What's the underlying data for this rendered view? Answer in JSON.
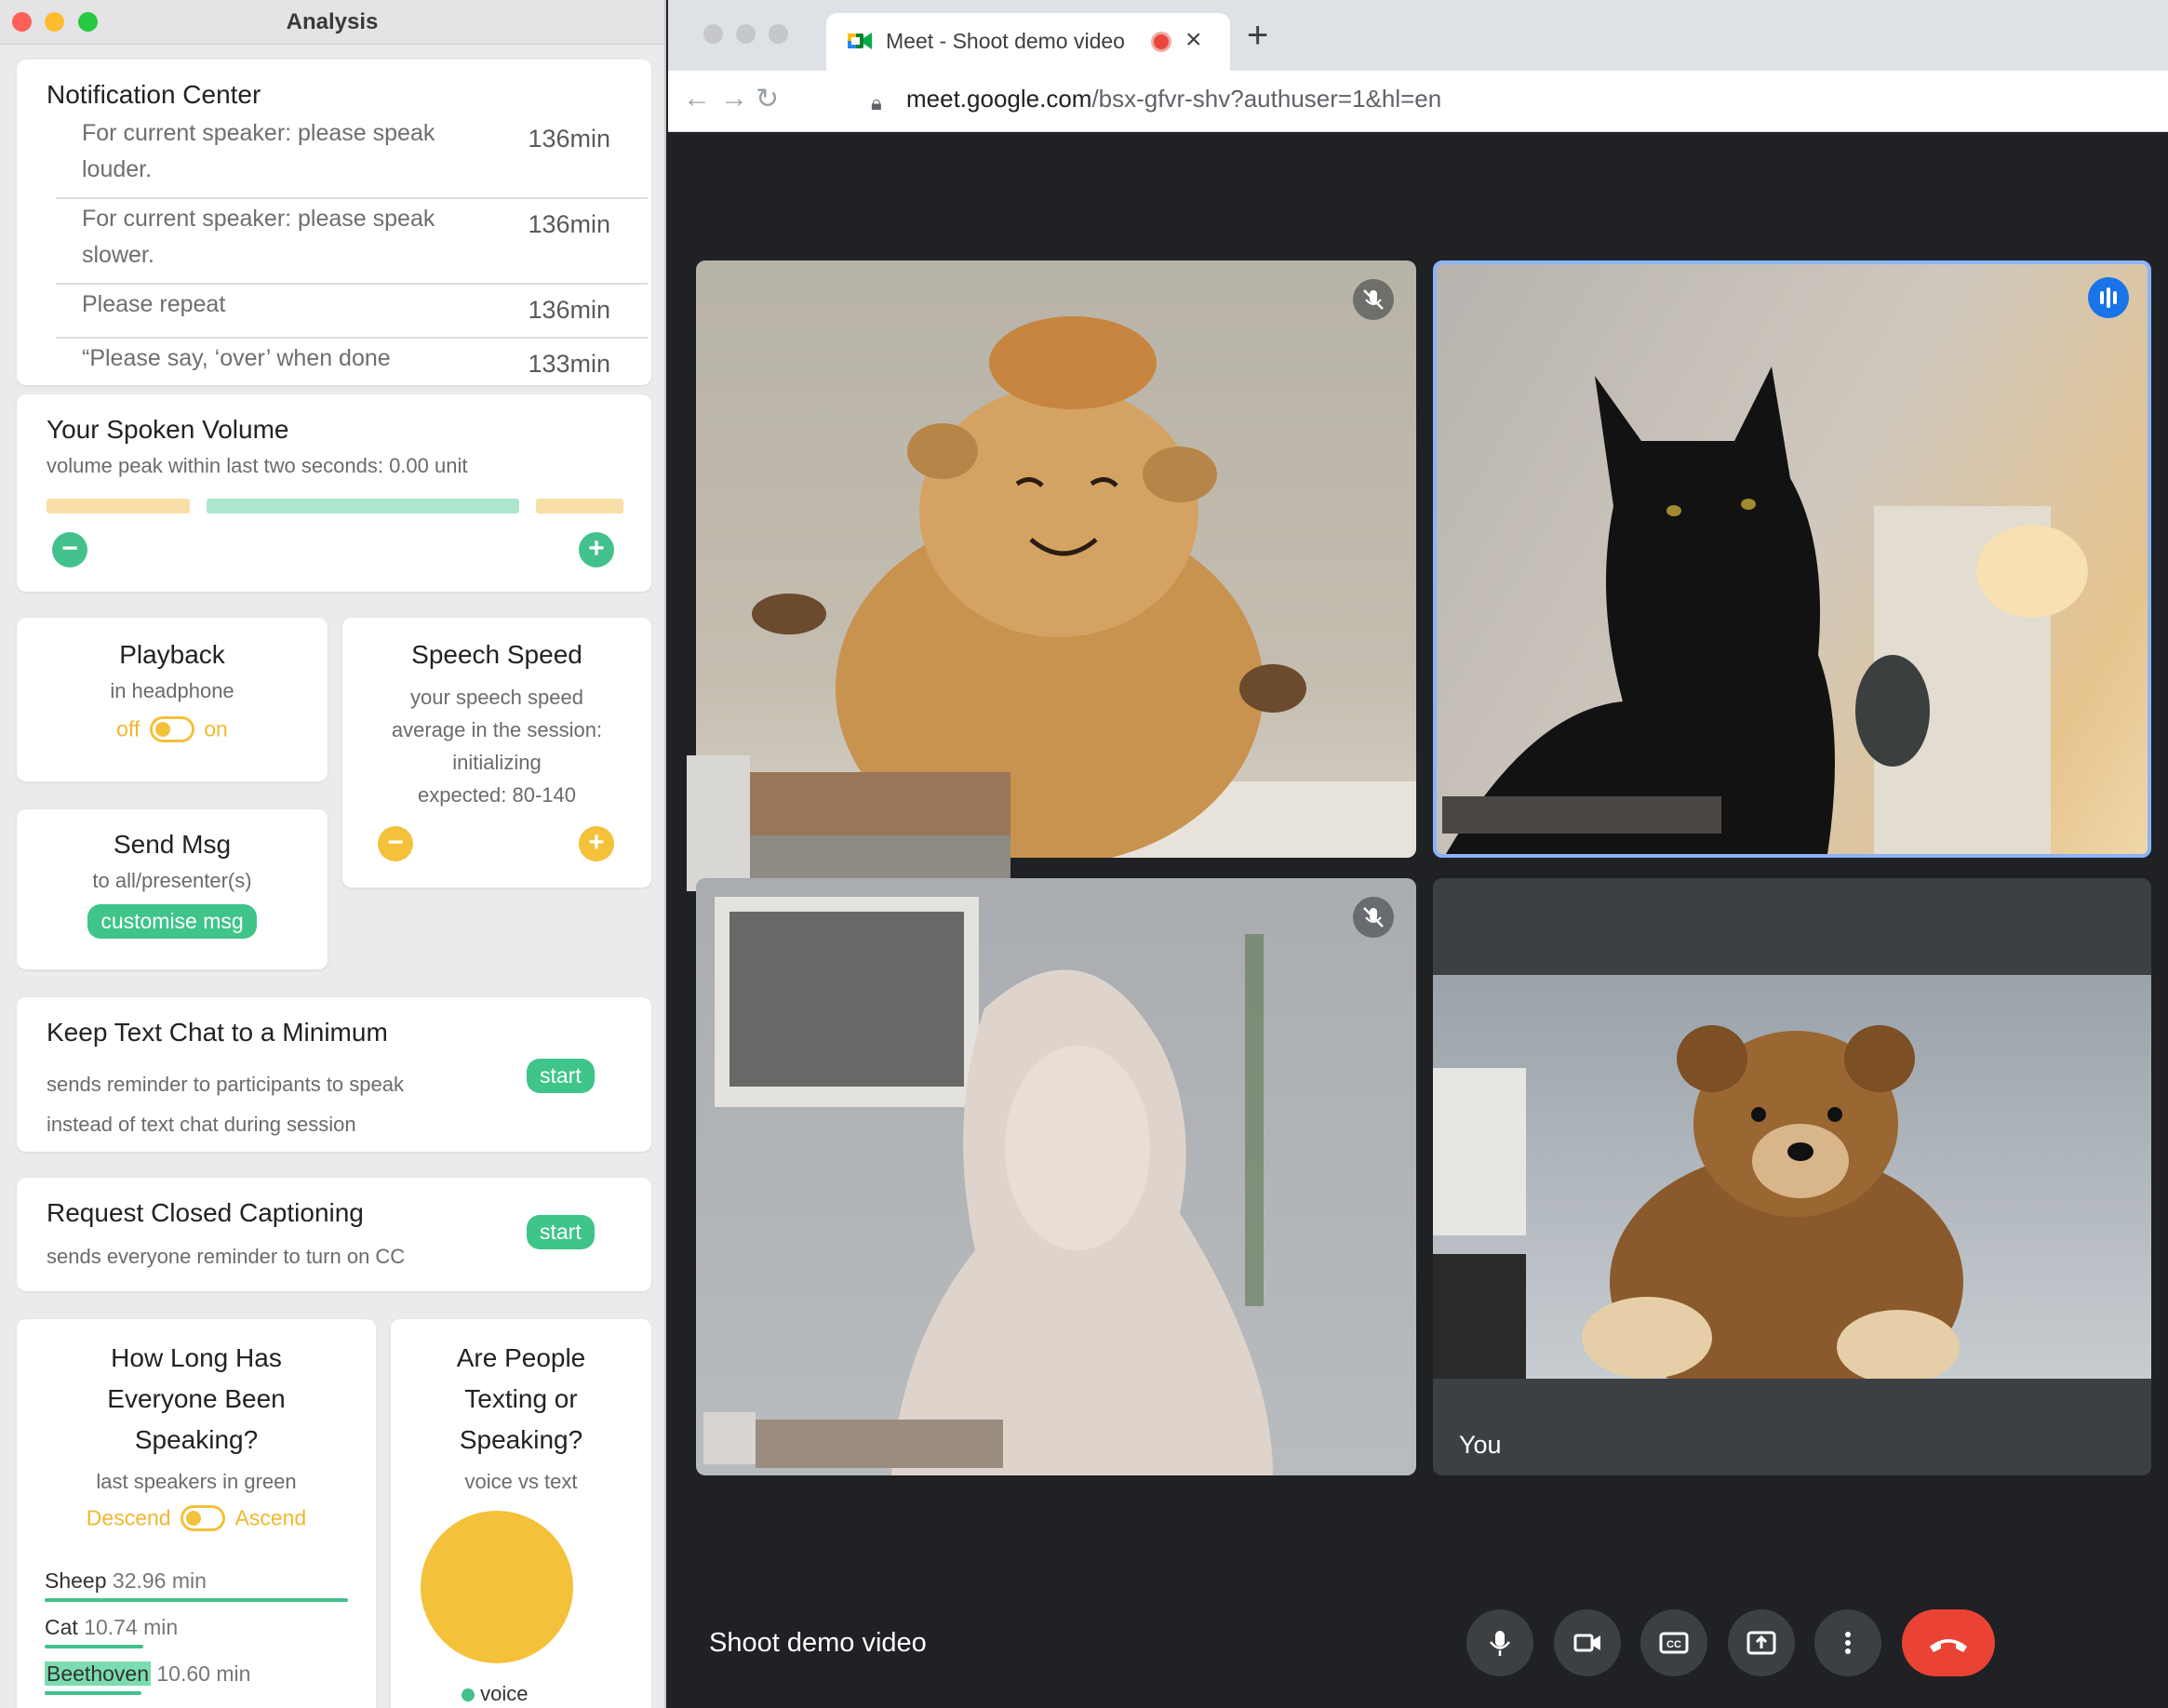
{
  "analysis_window": {
    "title": "Analysis",
    "notification_center": {
      "title": "Notification Center",
      "items": [
        {
          "line1": "For current speaker: please speak",
          "line2": "louder.",
          "time": "136min"
        },
        {
          "line1": "For current speaker: please speak",
          "line2": "slower.",
          "time": "136min"
        },
        {
          "line1": "Please repeat",
          "line2": "",
          "time": "136min"
        },
        {
          "line1": "“Please say, ‘over’ when done",
          "line2": "",
          "time": "133min"
        }
      ]
    },
    "volume": {
      "title": "Your Spoken Volume",
      "subtitle": "volume peak within last two seconds: 0.00 unit"
    },
    "playback": {
      "title": "Playback",
      "subtitle": "in headphone",
      "off_label": "off",
      "on_label": "on"
    },
    "speech_speed": {
      "title": "Speech Speed",
      "line1": "your speech speed",
      "line2": "average in the session:",
      "line3": "initializing",
      "line4": "expected: 80-140"
    },
    "send_msg": {
      "title": "Send Msg",
      "subtitle": "to all/presenter(s)",
      "button": "customise msg"
    },
    "text_chat": {
      "title": "Keep Text Chat to a Minimum",
      "line1": "sends reminder to participants to speak",
      "line2": "instead of text chat during session",
      "button": "start"
    },
    "captioning": {
      "title": "Request Closed Captioning",
      "subtitle": "sends everyone reminder to turn on CC",
      "button": "start"
    },
    "speaking_time": {
      "title_l1": "How Long Has",
      "title_l2": "Everyone Been",
      "title_l3": "Speaking?",
      "subtitle": "last speakers in green",
      "descend": "Descend",
      "ascend": "Ascend",
      "rows": [
        {
          "name": "Sheep",
          "mins": "32.96 min"
        },
        {
          "name": "Cat",
          "mins": "10.74 min"
        },
        {
          "name": "Beethoven",
          "mins": "10.60 min"
        }
      ]
    },
    "texting": {
      "title_l1": "Are People",
      "title_l2": "Texting or",
      "title_l3": "Speaking?",
      "subtitle": "voice vs text",
      "legend_voice": "voice"
    }
  },
  "browser": {
    "tab_title": "Meet - Shoot demo video",
    "url_host": "meet.google.com",
    "url_path": "/bsx-gfvr-shv?authuser=1&hl=en",
    "self_label": "You",
    "meeting_name": "Shoot demo video"
  },
  "colors": {
    "accent_green": "#42c18c",
    "accent_yellow": "#f3c13a",
    "end_call_red": "#ea4335",
    "active_speaker_blue": "#8ab4f8"
  },
  "icons": [
    "mic-off-icon",
    "speaking-indicator-icon",
    "microphone-icon",
    "camera-icon",
    "captions-icon",
    "present-icon",
    "more-icon",
    "end-call-icon",
    "lock-icon",
    "back-icon",
    "forward-icon",
    "reload-icon",
    "meet-icon",
    "recording-icon"
  ]
}
